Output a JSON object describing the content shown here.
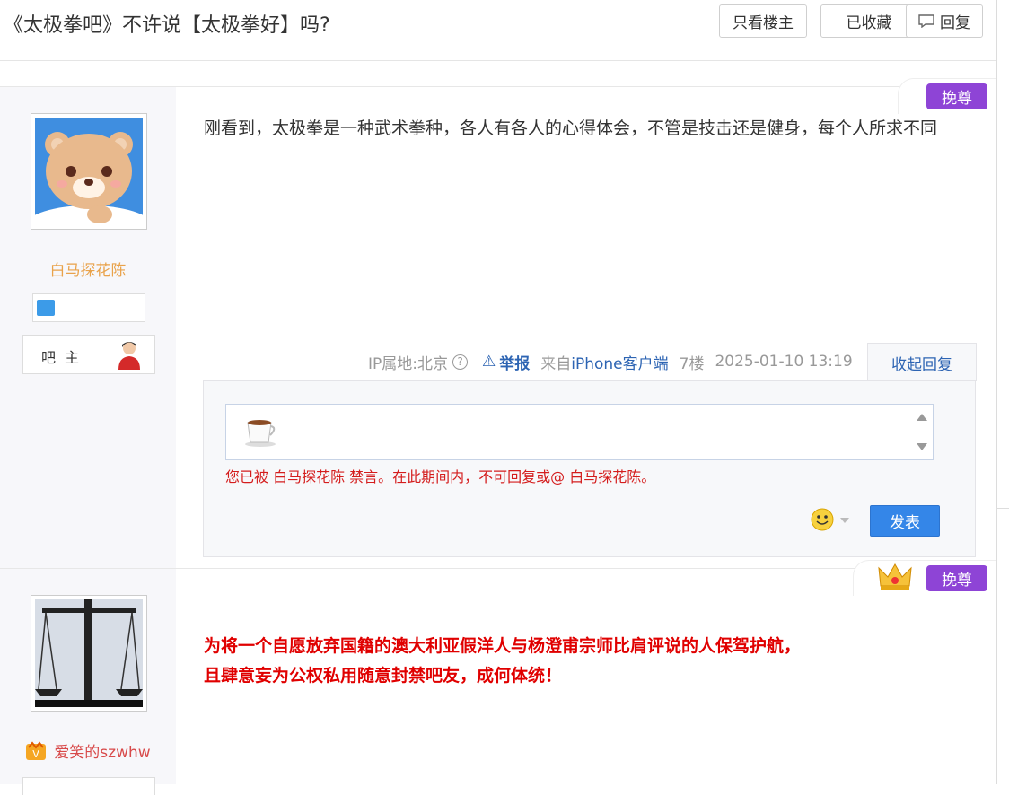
{
  "header": {
    "title": "《太极拳吧》不许说【太极拳好】吗?",
    "buttons": {
      "only_op": "只看楼主",
      "favorited": "已收藏",
      "reply": "回复"
    }
  },
  "posts": [
    {
      "username": "白马探花陈",
      "role": "吧主",
      "badge": "挽尊",
      "content": "刚看到，太极拳是一种武术拳种，各人有各人的心得体会，不管是技击还是健身，每个人所求不同",
      "meta": {
        "ip": "IP属地:北京",
        "report": "举报",
        "client_prefix": "来自",
        "client": "iPhone客户端",
        "floor": "7楼",
        "time": "2025-01-10 13:19",
        "collapse": "收起回复"
      },
      "reply_box": {
        "warning": "您已被 白马探花陈 禁言。在此期间内，不可回复或@ 白马探花陈。",
        "send_label": "发表"
      }
    },
    {
      "username": "爱笑的szwhw",
      "badge": "挽尊",
      "content_lines": [
        "为将一个自愿放弃国籍的澳大利亚假洋人与杨澄甫宗师比肩评说的人保驾护航，",
        "且肆意妄为公权私用随意封禁吧友，成何体统！"
      ]
    }
  ],
  "colors": {
    "link": "#2d64b3",
    "username_1": "#e9a24a",
    "username_2": "#d84a4a",
    "warning": "#d41d1d",
    "content_red": "#e00000",
    "send_button": "#3486e8",
    "badge": "#8e44d6"
  }
}
